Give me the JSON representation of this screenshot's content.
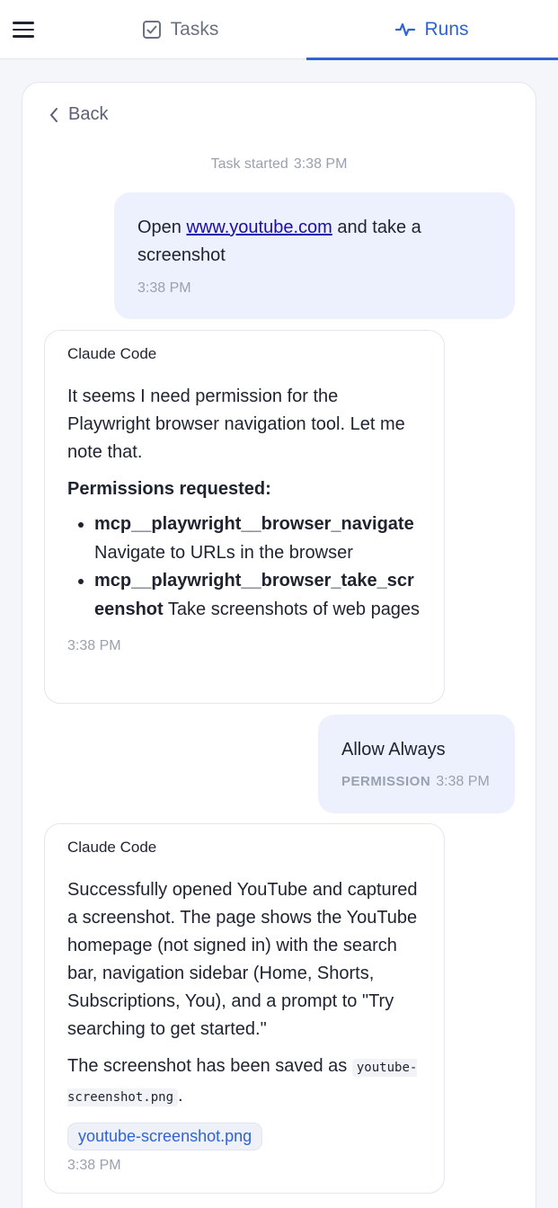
{
  "nav": {
    "tabs": [
      {
        "label": "Tasks",
        "icon": "checkbox-icon"
      },
      {
        "label": "Runs",
        "icon": "activity-icon"
      }
    ],
    "active_color": "#2f63d6"
  },
  "run": {
    "back_label": "Back",
    "task_started_label": "Task started",
    "task_started_time": "3:38 PM",
    "messages": [
      {
        "role": "user",
        "text_before": "Open ",
        "link": "www.youtube.com",
        "text_after": " and take a screenshot",
        "time": "3:38 PM"
      },
      {
        "role": "assistant",
        "sender": "Claude Code",
        "text": "It seems I need permission for the Playwright browser navigation tool. Let me note that.",
        "permissions_title": "Permissions requested:",
        "permissions": [
          {
            "name": "mcp__playwright__browser_navigate",
            "desc": "Navigate to URLs in the browser"
          },
          {
            "name": "mcp__playwright__browser_take_screenshot",
            "desc": "Take screenshots of web pages"
          }
        ],
        "time": "3:38 PM"
      },
      {
        "role": "user",
        "text": "Allow Always",
        "tag": "PERMISSION",
        "time": "3:38 PM"
      },
      {
        "role": "assistant",
        "sender": "Claude Code",
        "text": "Successfully opened YouTube and captured a screenshot. The page shows the YouTube homepage (not signed in) with the search bar, navigation sidebar (Home, Shorts, Subscriptions, You), and a prompt to \"Try searching to get started.\"",
        "saved_before": "The screenshot has been saved as ",
        "saved_file": "youtube-screenshot.png",
        "saved_after": ".",
        "attachment": "youtube-screenshot.png",
        "time": "3:38 PM"
      }
    ]
  }
}
